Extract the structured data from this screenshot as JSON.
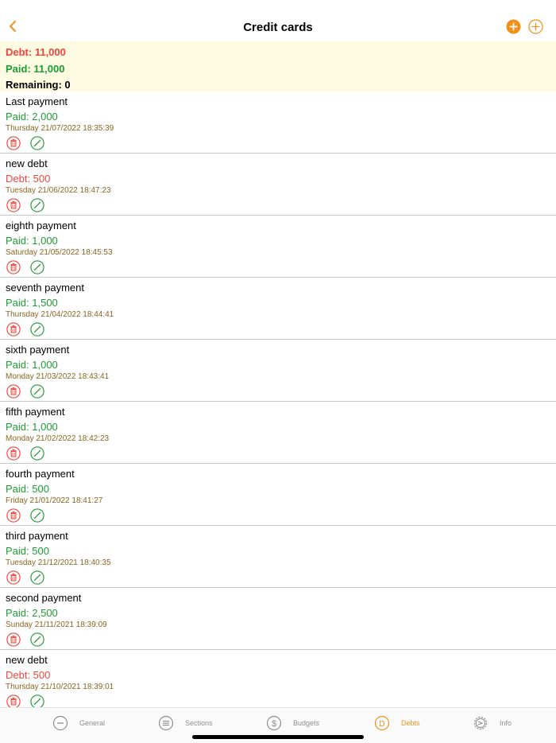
{
  "nav": {
    "title": "Credit cards",
    "back_icon": "chevron-left-icon",
    "accent": "#f0911e"
  },
  "summary": {
    "debt": "Debt: 11,000",
    "paid": "Paid: 11,000",
    "remaining": "Remaining: 0"
  },
  "colors": {
    "debt": "#f0443a",
    "paid": "#1f9b33",
    "date": "#8a6520"
  },
  "items": [
    {
      "name": "Last payment",
      "amount": "Paid: 2,000",
      "kind": "paid",
      "date": "Thursday 21/07/2022 18:35:39"
    },
    {
      "name": "new debt",
      "amount": "Debt: 500",
      "kind": "debt",
      "date": "Tuesday 21/06/2022 18:47:23"
    },
    {
      "name": "eighth payment",
      "amount": "Paid: 1,000",
      "kind": "paid",
      "date": "Saturday 21/05/2022 18:45:53"
    },
    {
      "name": "seventh payment",
      "amount": "Paid: 1,500",
      "kind": "paid",
      "date": "Thursday 21/04/2022 18:44:41"
    },
    {
      "name": "sixth payment",
      "amount": "Paid: 1,000",
      "kind": "paid",
      "date": "Monday 21/03/2022 18:43:41"
    },
    {
      "name": "fifth payment",
      "amount": "Paid: 1,000",
      "kind": "paid",
      "date": "Monday 21/02/2022 18:42:23"
    },
    {
      "name": "fourth payment",
      "amount": "Paid: 500",
      "kind": "paid",
      "date": "Friday 21/01/2022 18:41:27"
    },
    {
      "name": "third payment",
      "amount": "Paid: 500",
      "kind": "paid",
      "date": "Tuesday 21/12/2021 18:40:35"
    },
    {
      "name": "second payment",
      "amount": "Paid: 2,500",
      "kind": "paid",
      "date": "Sunday 21/11/2021 18:39:09"
    },
    {
      "name": "new debt",
      "amount": "Debt: 500",
      "kind": "debt",
      "date": "Thursday 21/10/2021 18:39:01"
    }
  ],
  "tabs": [
    {
      "label": "General",
      "icon": "minus-circle-icon",
      "active": false
    },
    {
      "label": "Sections",
      "icon": "list-circle-icon",
      "active": false
    },
    {
      "label": "Budgets",
      "icon": "dollar-circle-icon",
      "active": false
    },
    {
      "label": "Debts",
      "icon": "d-circle-icon",
      "active": true
    },
    {
      "label": "Info",
      "icon": "gear-icon",
      "active": false
    }
  ]
}
